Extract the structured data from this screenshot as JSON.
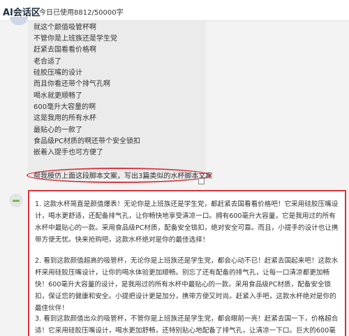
{
  "header": {
    "brand": "AI会话区",
    "usage": "今日已使用8812/50000字"
  },
  "user_message": {
    "lines": [
      "就这个颜值吸管杯啊",
      "不管你是上班族还是学生党",
      "赶紧去国看看价格啊",
      "老合适了",
      "硅胶压嘴的设计",
      "而且你看还带个排气孔啊",
      "喝水就更顺畅了",
      "600毫升大容量的啊",
      "这是我用的所有水杯",
      "最贴心的一款了",
      "食品级PC材质的啊还带个安全锁扣",
      "嵌着入提手也可方便了",
      "",
      "帮我模仿上面这段脚本文案，写出3篇类似的水杯脚本文案"
    ]
  },
  "ai_message": {
    "paragraphs": [
      "1. 这款水杯简直是颜值爆表！无论你是上班族还是学生党，都赶紧去国看看价格吧！它采用硅胶压嘴设计，喝水更舒适，还配备排气孔，让你畅快地享受清凉一口。拥有600毫升大容量，它是我用过的所有水杯中最贴心的一款。采用食品级PC材质，配备安全锁扣，绝对安全可靠。而且，小提手的设计也让携带方便无忧。快来抢购吧，这款水杯绝对是你的最佳选择！",
      "2. 看到这款颜值超高的吸管杯，无论你是上班族还是学生党，都会心动不已！赶紧去国起来吧！这款水杯采用硅胶压嘴设计，让你的喝水体验更加顺畅。别忘了还有配备的排气孔，让每一口清凉都更加畅快！600毫升大容量的设计，是我用过的所有水杯中最贴心的一款。采用食品级PC材质，配备安全锁扣，保证您的健康和安全。小提把设计更是加分，携带方便又时尚。赶紧入手吧，这款水杯绝对是你的最佳伙伴！",
      "3. 看到这款颜值出众的吸管杯，不管你是上班族还是学生党，都会眼前一亮！赶紧去国一下，价格超合适！它采用硅胶压嘴设计，喝水更加舒畅，还特别贴心地配备了排气孔，让清凉一下口。巨大的600毫升"
    ]
  },
  "colors": {
    "highlight_red": "#d9333a",
    "ai_green": "#6cc04a"
  },
  "icons": [
    "user-avatar-icon",
    "ai-avatar-icon",
    "copy-icon"
  ]
}
